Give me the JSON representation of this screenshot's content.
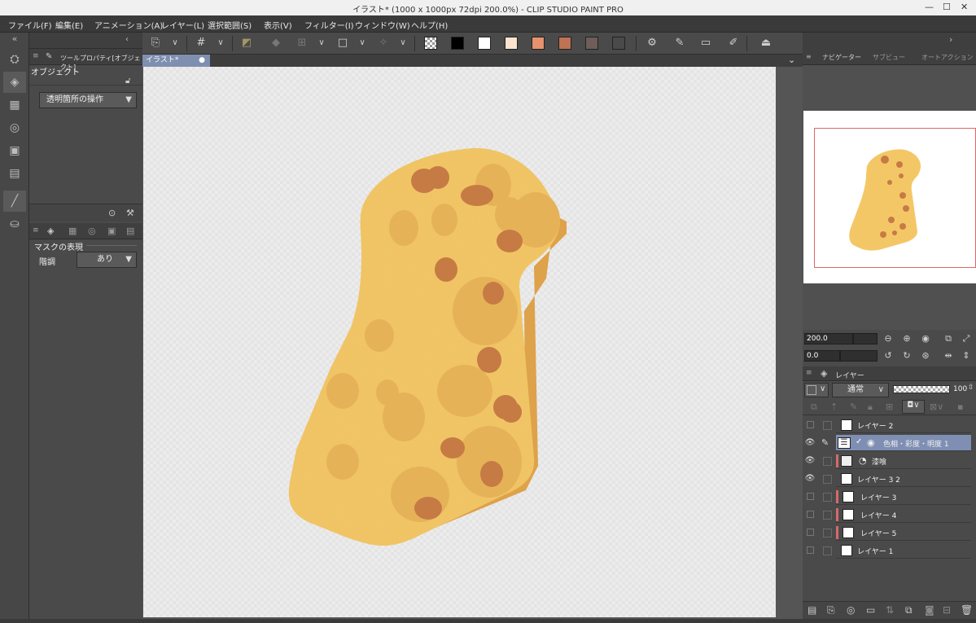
{
  "window": {
    "title": "イラスト* (1000 x 1000px 72dpi 200.0%)  - CLIP STUDIO PAINT PRO",
    "minimize": "—",
    "maximize": "☐",
    "close": "✕"
  },
  "menu": [
    "ファイル(F)",
    "編集(E)",
    "アニメーション(A)",
    "レイヤー(L)",
    "選択範囲(S)",
    "表示(V)",
    "フィルター(I)",
    "ウィンドウ(W)",
    "ヘルプ(H)"
  ],
  "toolbar": {
    "swatches": [
      "#ffffff",
      "#000000",
      "#ffffff",
      "#fbe3cf",
      "#e6936d",
      "#c07254",
      "#6e5d5a",
      "#4a4a4a"
    ]
  },
  "tool_property": {
    "tab_label": "ツールプロパティ[オブジェクト]",
    "section": "オブジェクト",
    "dropdown": "透明箇所の操作"
  },
  "sub_property": {
    "section": "マスクの表現",
    "field_label": "階調",
    "field_value": "あり"
  },
  "document": {
    "tab_label": "イラスト*"
  },
  "navigator": {
    "tabs": [
      "ナビゲーター",
      "サブビュー",
      "オートアクション"
    ],
    "zoom": "200.0",
    "rotation": "0.0"
  },
  "layer_panel": {
    "tab_label": "レイヤー",
    "blend_mode": "通常",
    "opacity": "100",
    "layers": [
      {
        "name": "レイヤー 2",
        "visible": false,
        "selected": false,
        "red": false,
        "indent": false
      },
      {
        "name": "色相・彩度・明度 1",
        "visible": true,
        "selected": true,
        "red": false,
        "indent": false
      },
      {
        "name": "漆喰",
        "visible": true,
        "selected": false,
        "red": true,
        "indent": true
      },
      {
        "name": "レイヤー 3 2",
        "visible": true,
        "selected": false,
        "red": false,
        "indent": false
      },
      {
        "name": "レイヤー 3",
        "visible": false,
        "selected": false,
        "red": true,
        "indent": false
      },
      {
        "name": "レイヤー 4",
        "visible": false,
        "selected": false,
        "red": true,
        "indent": false
      },
      {
        "name": "レイヤー 5",
        "visible": false,
        "selected": false,
        "red": true,
        "indent": false
      },
      {
        "name": "レイヤー 1",
        "visible": false,
        "selected": false,
        "red": false,
        "indent": false
      }
    ]
  },
  "colors": {
    "sponge_base": "#f4c766",
    "sponge_shade": "#e2ac4e",
    "sponge_spot": "#c67b45",
    "selection": "#7f8fb3",
    "layer_warning": "#d46a6a"
  },
  "icons": [
    "collapse-icon",
    "grid-icon",
    "transparent-swatch-icon",
    "pen-icon",
    "lock-icon",
    "eye-icon",
    "folder-icon",
    "trash-icon",
    "zoom-in-icon",
    "zoom-out-icon"
  ]
}
